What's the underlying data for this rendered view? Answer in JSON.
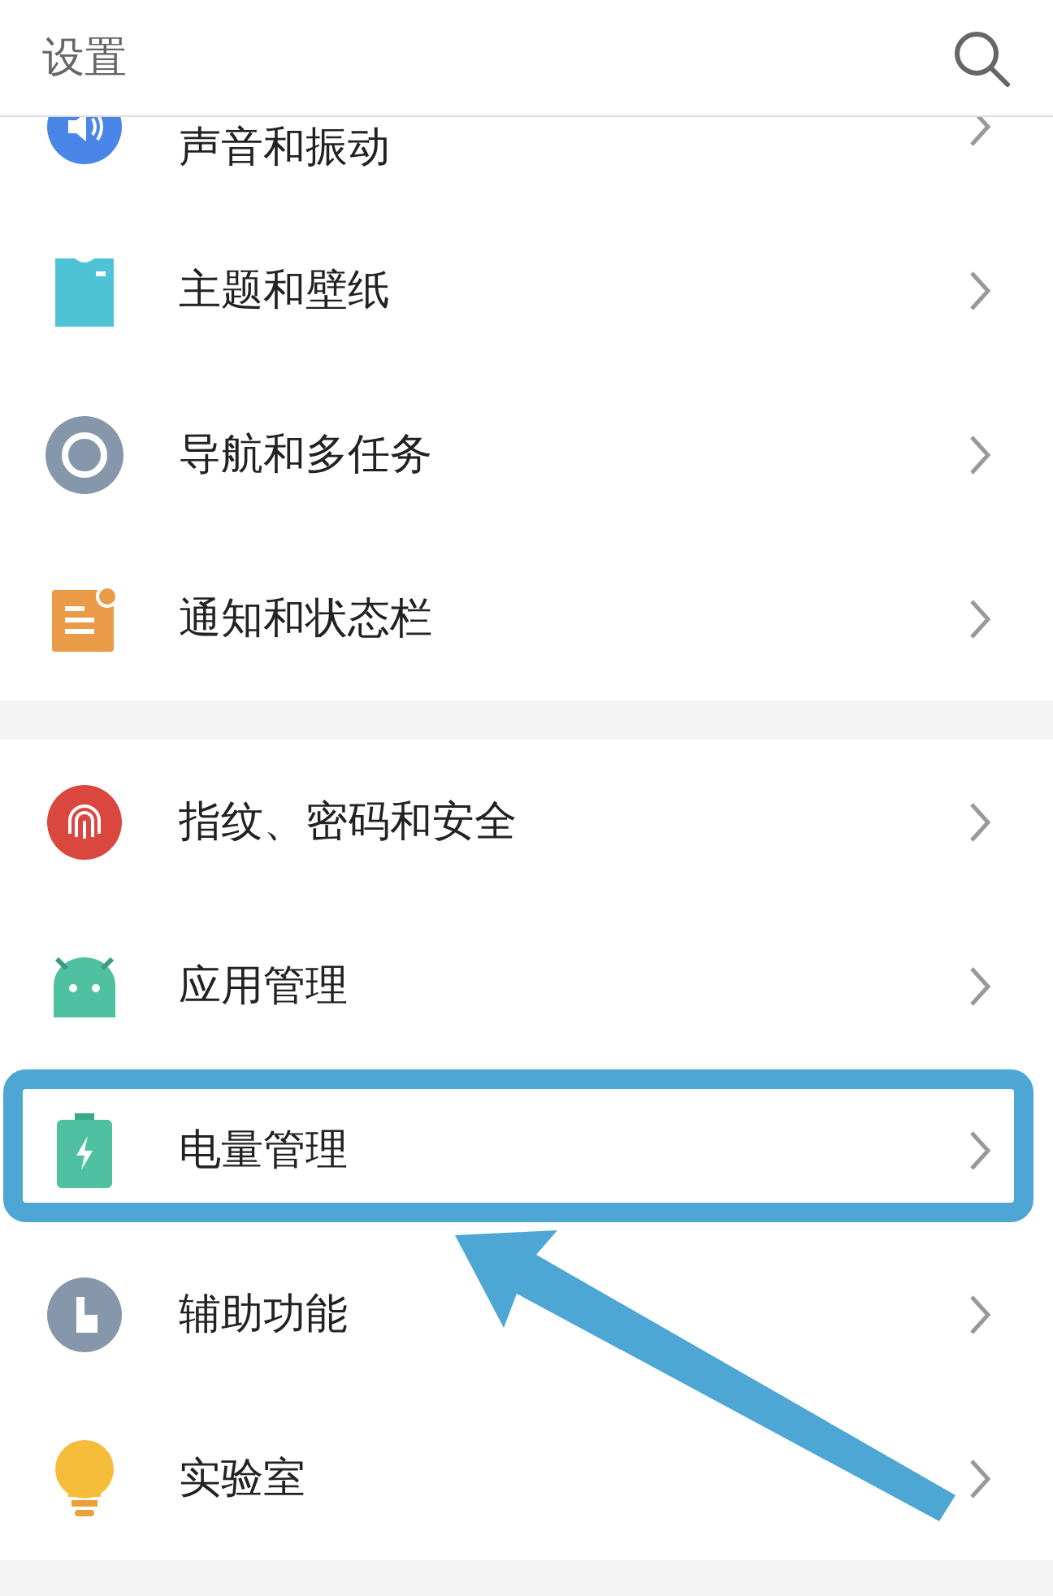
{
  "header": {
    "title": "设置"
  },
  "groups": [
    {
      "items": [
        {
          "label": "声音和振动",
          "highlighted": false
        },
        {
          "label": "主题和壁纸",
          "highlighted": false
        },
        {
          "label": "导航和多任务",
          "highlighted": false
        },
        {
          "label": "通知和状态栏",
          "highlighted": false
        }
      ]
    },
    {
      "items": [
        {
          "label": "指纹、密码和安全",
          "highlighted": false
        },
        {
          "label": "应用管理",
          "highlighted": false
        },
        {
          "label": "电量管理",
          "highlighted": true
        },
        {
          "label": "辅助功能",
          "highlighted": false
        },
        {
          "label": "实验室",
          "highlighted": false
        }
      ]
    }
  ]
}
